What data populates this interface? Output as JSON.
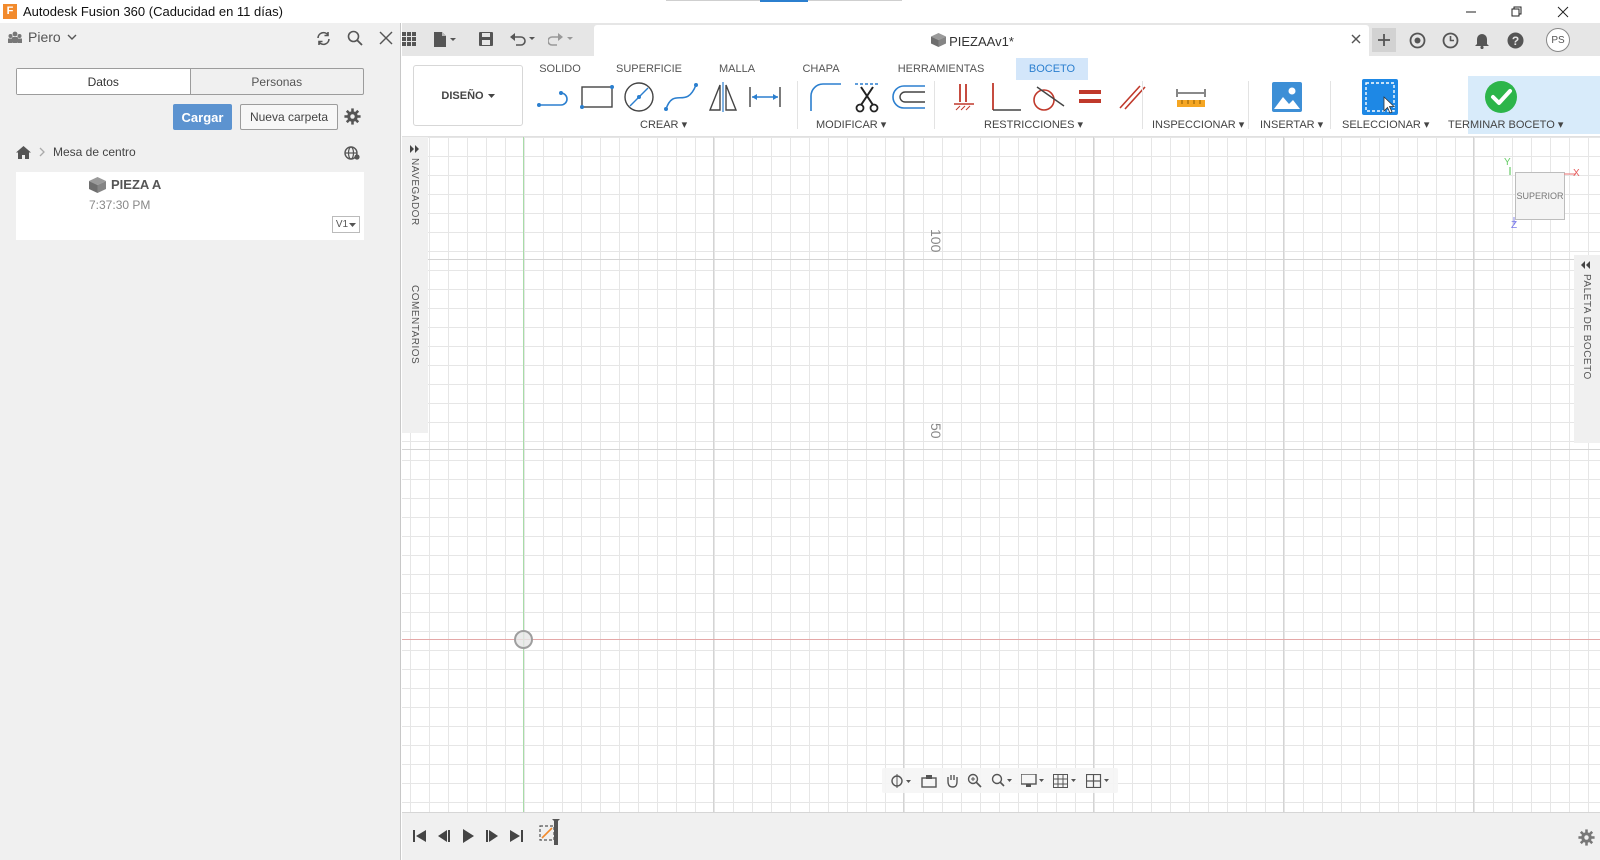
{
  "window": {
    "app_logo_letter": "F",
    "title": "Autodesk Fusion 360 (Caducidad en 11 días)",
    "controls": [
      "minimize-icon",
      "restore-icon",
      "close-icon"
    ]
  },
  "data_panel": {
    "user": "Piero",
    "tabs": [
      "Datos",
      "Personas"
    ],
    "active_tab": "Datos",
    "upload_button": "Cargar",
    "new_folder_button": "Nueva carpeta",
    "breadcrumb": "Mesa de centro",
    "files": [
      {
        "name": "PIEZA A",
        "time": "7:37:30 PM",
        "version": "V1"
      }
    ]
  },
  "document": {
    "tab_title": "PIEZAAv1*",
    "user_initials": "PS"
  },
  "toolbar": {
    "workspace": "DISEÑO",
    "ribbon_tabs": [
      "SOLIDO",
      "SUPERFICIE",
      "MALLA",
      "CHAPA",
      "HERRAMIENTAS",
      "BOCETO"
    ],
    "active_tab": "BOCETO",
    "groups": [
      "CREAR",
      "MODIFICAR",
      "RESTRICCIONES",
      "INSPECCIONAR",
      "INSERTAR",
      "SELECCIONAR",
      "TERMINAR BOCETO"
    ]
  },
  "canvas": {
    "side_left_top": "NAVEGADOR",
    "side_left_bottom": "COMENTARIOS",
    "side_right": "PALETA DE BOCETO",
    "viewcube_face": "SUPERIOR",
    "axis_x": "X",
    "axis_y": "Y",
    "axis_z": "Z",
    "ruler_labels": [
      "100",
      "50"
    ]
  },
  "colors": {
    "accent": "#5c93d0",
    "active_tab_bg": "#d3e6fa",
    "finish_green": "#2db54a",
    "axis_red": "#e4a8a8",
    "axis_green": "#a8dca8"
  }
}
